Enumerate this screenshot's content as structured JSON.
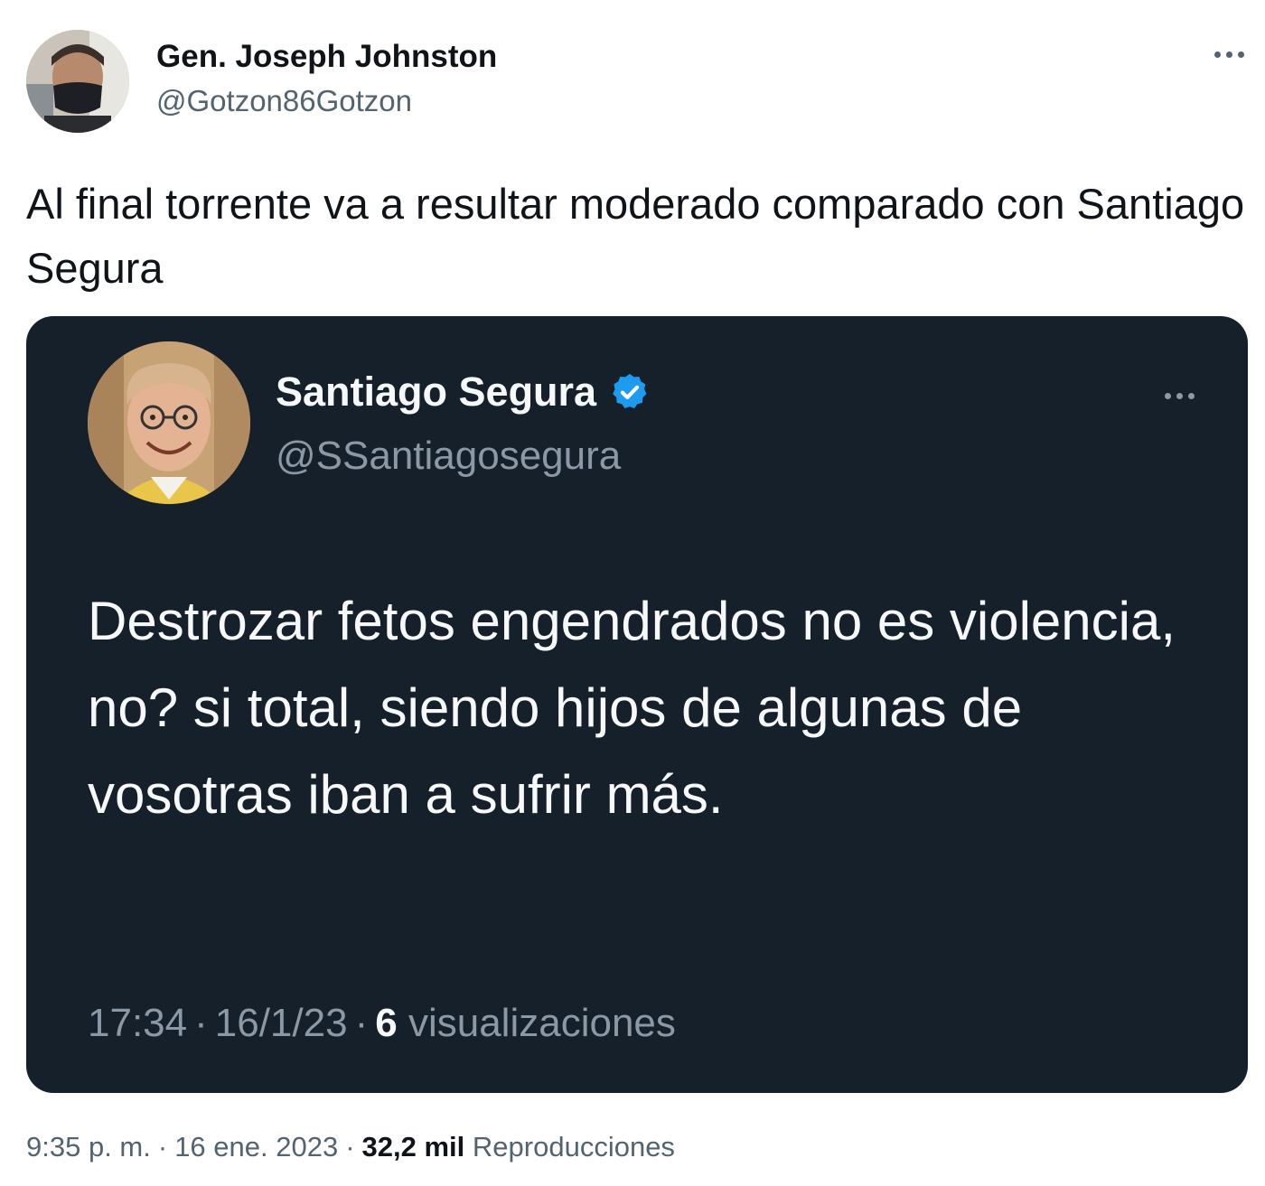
{
  "tweet": {
    "author_name": "Gen. Joseph Johnston",
    "author_handle": "@Gotzon86Gotzon",
    "text": "Al final torrente va a resultar moderado comparado con Santiago Segura",
    "time": "9:35 p. m.",
    "date": "16 ene. 2023",
    "views_count": "32,2 mil",
    "views_label": "Reproducciones",
    "more_icon": "more-horizontal-icon"
  },
  "quoted": {
    "author_name": "Santiago Segura",
    "author_handle": "@SSantiagosegura",
    "verified_icon": "verified-badge-icon",
    "text": "Destrozar fetos engendrados no es violencia, no? si total, siendo hijos de algunas de vosotras iban a sufrir más.",
    "time": "17:34",
    "date": "16/1/23",
    "views_count": "6",
    "views_label": "visualizaciones",
    "more_icon": "more-horizontal-icon"
  },
  "colors": {
    "card_bg": "#15202b",
    "secondary_text": "#536471",
    "verified_blue": "#1d9bf0"
  }
}
